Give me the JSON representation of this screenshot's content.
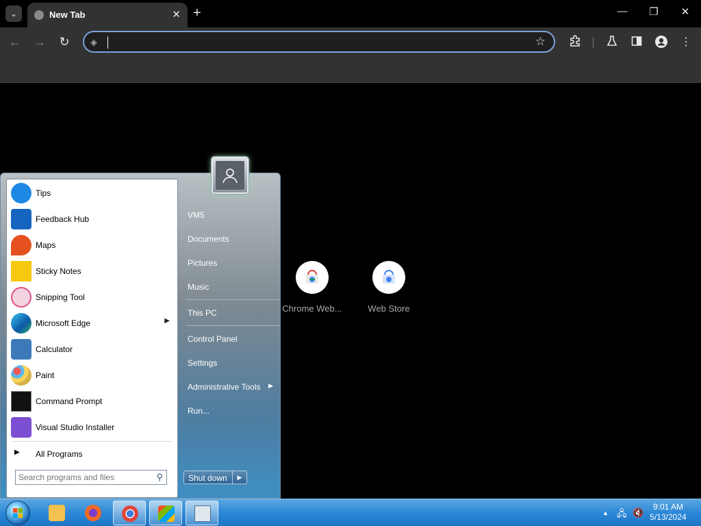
{
  "browser": {
    "tab_title": "New Tab",
    "omnibox_value": "",
    "icons": {
      "tab_search": "chevron-down-icon",
      "favicon": "globe-icon",
      "tab_close": "close-icon",
      "new_tab": "plus-icon",
      "minimize": "minimize-icon",
      "restore": "restore-icon",
      "close_window": "close-icon",
      "back": "back-arrow-icon",
      "forward": "forward-arrow-icon",
      "reload": "reload-icon",
      "bookmark": "star-icon",
      "extensions": "puzzle-icon",
      "labs": "flask-icon",
      "side_panel": "side-panel-icon",
      "profile": "profile-icon",
      "menu": "kebab-menu-icon"
    }
  },
  "newtab": {
    "shortcuts": [
      {
        "label": "Chrome Web..."
      },
      {
        "label": "Web Store"
      }
    ]
  },
  "start_menu": {
    "programs": [
      {
        "label": "Tips",
        "icon": "lightbulb-icon",
        "color": "#1e88e5"
      },
      {
        "label": "Feedback Hub",
        "icon": "feedback-icon",
        "color": "#1565c0"
      },
      {
        "label": "Maps",
        "icon": "map-pin-icon",
        "color": "#e5511e"
      },
      {
        "label": "Sticky Notes",
        "icon": "sticky-note-icon",
        "color": "#f6c90e"
      },
      {
        "label": "Snipping Tool",
        "icon": "scissors-icon",
        "color": "#e04f86"
      },
      {
        "label": "Microsoft Edge",
        "icon": "edge-icon",
        "color": "#1a8fd6"
      },
      {
        "label": "Calculator",
        "icon": "calculator-icon",
        "color": "#3d79b8"
      },
      {
        "label": "Paint",
        "icon": "palette-icon",
        "color": "#d9b24a"
      },
      {
        "label": "Command Prompt",
        "icon": "terminal-icon",
        "color": "#111111"
      },
      {
        "label": "Visual Studio Installer",
        "icon": "visual-studio-icon",
        "color": "#7b4ed2"
      }
    ],
    "all_programs": "All Programs",
    "search_placeholder": "Search programs and files",
    "right_items": [
      {
        "label": "VM5"
      },
      {
        "label": "Documents"
      },
      {
        "label": "Pictures"
      },
      {
        "label": "Music"
      },
      {
        "label": "This PC"
      },
      {
        "label": "Control Panel"
      },
      {
        "label": "Settings"
      },
      {
        "label": "Administrative Tools"
      },
      {
        "label": "Run..."
      }
    ],
    "shutdown": "Shut down"
  },
  "taskbar": {
    "apps": [
      {
        "name": "file-explorer",
        "icon": "folder-icon",
        "color": "#f2c14e"
      },
      {
        "name": "firefox",
        "icon": "firefox-icon",
        "color": "#f06a24"
      },
      {
        "name": "chrome",
        "icon": "chrome-icon",
        "color": "#3b7de0"
      },
      {
        "name": "windows",
        "icon": "windows-flag-icon",
        "color": "#5fb34a"
      },
      {
        "name": "window-app",
        "icon": "window-icon",
        "color": "#dfe7ee"
      }
    ],
    "clock_time": "9:01 AM",
    "clock_date": "5/13/2024"
  }
}
